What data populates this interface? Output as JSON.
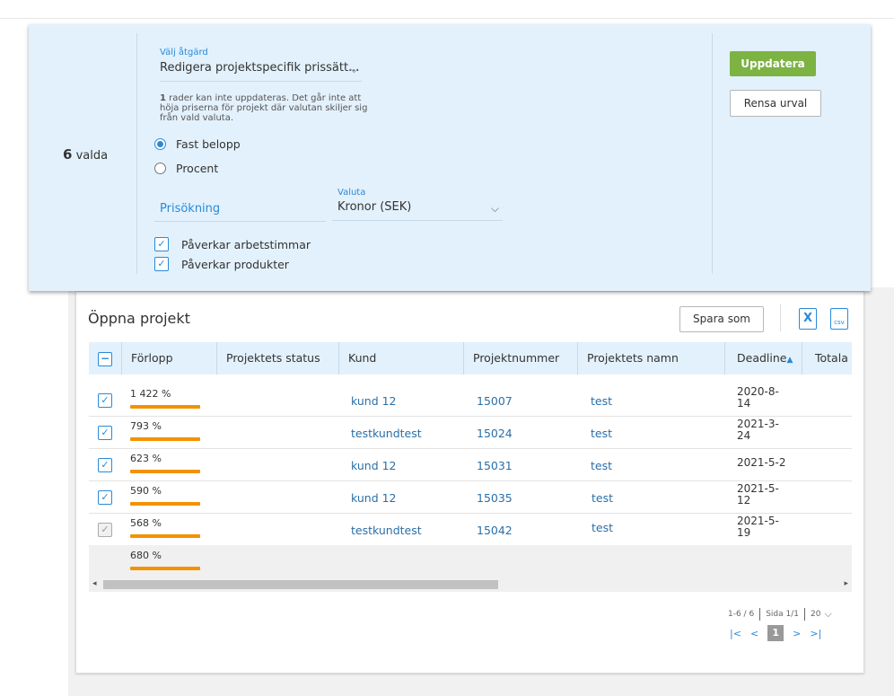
{
  "bulk": {
    "count": "6",
    "count_suffix": "valda",
    "action_label": "Välj åtgärd",
    "action_value": "Redigera projektspecifik prissätt...",
    "note_count": "1",
    "note_text": "rader kan inte uppdateras. Det går inte att höja priserna för projekt där valutan skiljer sig från vald valuta.",
    "radio_fixed": "Fast belopp",
    "radio_percent": "Procent",
    "price_increase_placeholder": "Prisökning",
    "currency_label": "Valuta",
    "currency_value": "Kronor (SEK)",
    "affects_hours": "Påverkar arbetstimmar",
    "affects_products": "Påverkar produkter",
    "update_button": "Uppdatera",
    "clear_button": "Rensa urval"
  },
  "projects": {
    "title": "Öppna projekt",
    "save_as": "Spara som",
    "export_excel_icon": "X",
    "export_csv_icon": "csv",
    "columns": {
      "progress": "Förlopp",
      "status": "Projektets status",
      "customer": "Kund",
      "number": "Projektnummer",
      "name": "Projektets namn",
      "deadline": "Deadline",
      "total": "Totala ..."
    },
    "rows": [
      {
        "progress": "1 422 %",
        "progress_value": 100,
        "customer": "kund 12",
        "number": "15007",
        "name": "test",
        "deadline": "2020-8-14",
        "checked": true,
        "disabled": false
      },
      {
        "progress": "793 %",
        "progress_value": 100,
        "customer": "testkundtest",
        "number": "15024",
        "name": "test",
        "deadline": "2021-3-24",
        "checked": true,
        "disabled": false
      },
      {
        "progress": "623 %",
        "progress_value": 100,
        "customer": "kund 12",
        "number": "15031",
        "name": "test",
        "deadline": "2021-5-2",
        "checked": true,
        "disabled": false
      },
      {
        "progress": "590 %",
        "progress_value": 100,
        "customer": "kund 12",
        "number": "15035",
        "name": "test",
        "deadline": "2021-5-12",
        "checked": true,
        "disabled": false
      },
      {
        "progress": "568 %",
        "progress_value": 100,
        "customer": "testkundtest",
        "number": "15042",
        "name": "test",
        "deadline": "2021-5-19",
        "checked": true,
        "disabled": true
      }
    ],
    "summary_progress": "680 %",
    "pager": {
      "range": "1-6 / 6",
      "page": "Sida 1/1",
      "per_page": "20",
      "current": "1"
    }
  },
  "colors": {
    "accent": "#2a8ad8",
    "panel": "#e3f1fc",
    "update": "#7cb342",
    "progress": "#f39200"
  }
}
